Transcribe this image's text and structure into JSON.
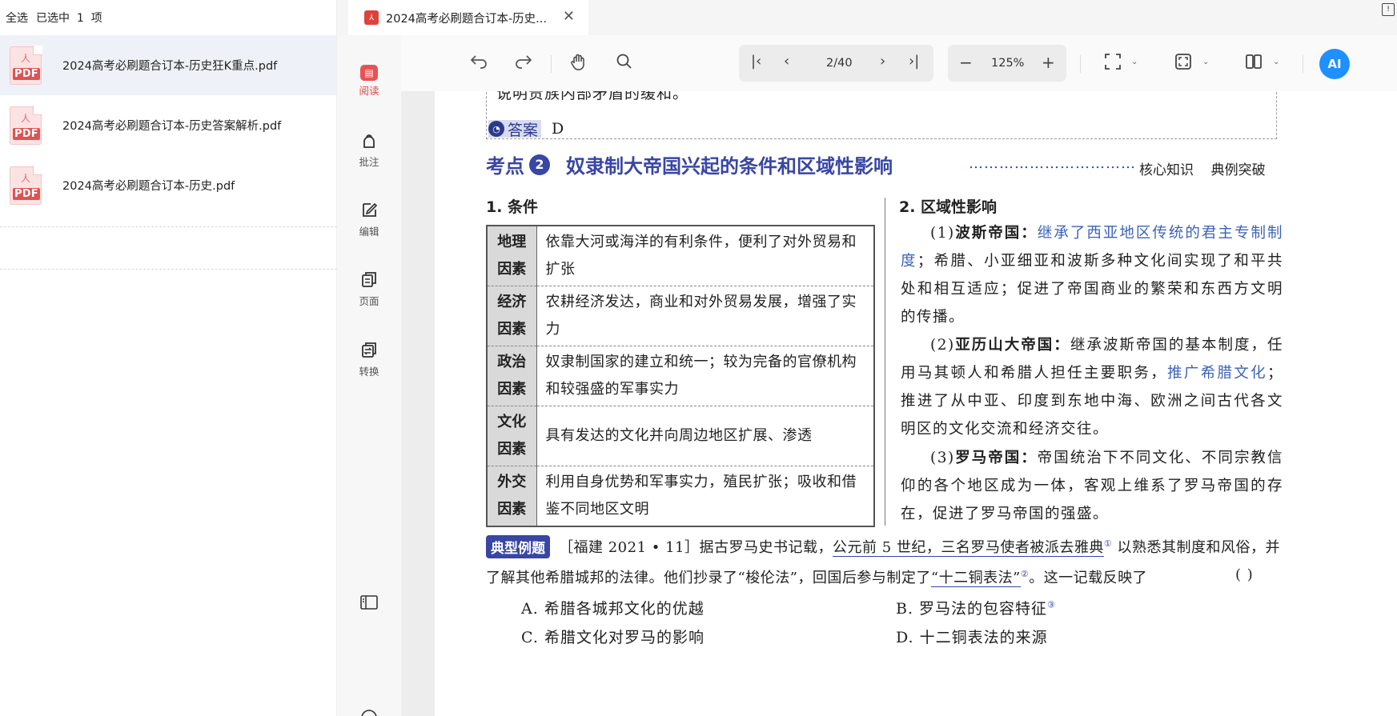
{
  "selection_bar": {
    "select_all": "全选",
    "selected_prefix": "已选中",
    "selected_count": "1",
    "selected_suffix": "项"
  },
  "files": [
    {
      "name": "2024高考必刷题合订本-历史狂K重点.pdf",
      "icon": "PDF"
    },
    {
      "name": "2024高考必刷题合订本-历史答案解析.pdf",
      "icon": "PDF"
    },
    {
      "name": "2024高考必刷题合订本-历史.pdf",
      "icon": "PDF"
    }
  ],
  "tab": {
    "title": "2024高考必刷题合订本-历史...",
    "close": "✕"
  },
  "rail": {
    "read": "阅读",
    "annotate": "批注",
    "edit": "编辑",
    "pages": "页面",
    "convert": "转换"
  },
  "toolbar": {
    "page": "2/40",
    "zoom": "125%",
    "ai": "AI"
  },
  "colors": {
    "accent": "#3846a4",
    "read_active": "#e55353",
    "ai_button": "#1e90ff"
  },
  "doc": {
    "top_line": "说明贵族内部矛盾的缓和。",
    "answer_label": "答案",
    "answer_value": "D",
    "kaodian": "考点",
    "kaodian_num": "2",
    "heading": "奴隶制大帝国兴起的条件和区域性影响",
    "dots": "……………………………",
    "tag1": "核心知识",
    "tag2": "典例突破",
    "sec1": "1. 条件",
    "sec2": "2. 区域性影响",
    "conditions": [
      {
        "k1": "地理",
        "k2": "因素",
        "v": "依靠大河或海洋的有利条件，便利了对外贸易和扩张"
      },
      {
        "k1": "经济",
        "k2": "因素",
        "v": "农耕经济发达，商业和对外贸易发展，增强了实力"
      },
      {
        "k1": "政治",
        "k2": "因素",
        "v": "奴隶制国家的建立和统一；较为完备的官僚机构和较强盛的军事实力"
      },
      {
        "k1": "文化",
        "k2": "因素",
        "v": "具有发达的文化并向周边地区扩展、渗透"
      },
      {
        "k1": "外交",
        "k2": "因素",
        "v": "利用自身优势和军事实力，殖民扩张；吸收和借鉴不同地区文明"
      }
    ],
    "p1_num": "(1)",
    "p1_name": "波斯帝国：",
    "p1_blue": "继承了西亚地区传统的君主专制制度",
    "p1_rest": "；希腊、小亚细亚和波斯多种文化间实现了和平共处和相互适应；促进了帝国商业的繁荣和东西方文明的传播。",
    "p2_num": "(2)",
    "p2_name": "亚历山大帝国：",
    "p2_a": "继承波斯帝国的基本制度，任用马其顿人和希腊人担任主要职务，",
    "p2_blue": "推广希腊文化",
    "p2_b": "；推进了从中亚、印度到东地中海、欧洲之间古代各文明区的文化交流和经济交往。",
    "p3_num": "(3)",
    "p3_name": "罗马帝国：",
    "p3_rest": "帝国统治下不同文化、不同宗教信仰的各个地区成为一体，客观上维系了罗马帝国的存在，促进了罗马帝国的强盛。",
    "example_badge": "典型例题",
    "ex_src": "［福建 2021 • 11］据古罗马史书记载，",
    "ex_ul1": "公元前 5 世纪，三名罗马使者被派去雅典",
    "ex_sup1": "①",
    "ex_mid": " 以熟悉其制度和风俗，并",
    "ex_line2a": "了解其他希腊城邦的法律。他们抄录了“梭伦法”，回国后参与制定了",
    "ex_ul2": "“十二铜表法”",
    "ex_sup2": "②",
    "ex_line2b": "。这一记载反映了",
    "ex_paren": "(          )",
    "optA": "A. 希腊各城邦文化的优越",
    "optB": "B. 罗马法的包容特征",
    "optB_sup": "③",
    "optC": "C. 希腊文化对罗马的影响",
    "optD": "D. 十二铜表法的来源"
  }
}
